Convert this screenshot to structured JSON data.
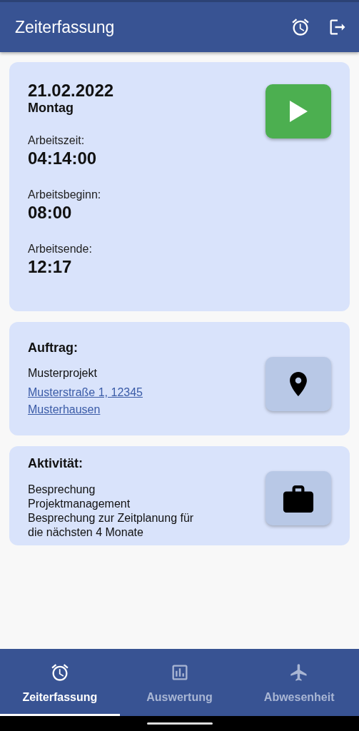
{
  "app_bar": {
    "title": "Zeiterfassung"
  },
  "time_card": {
    "date": "21.02.2022",
    "weekday": "Montag",
    "running": false,
    "fields": [
      {
        "label": "Arbeitszeit:",
        "value": "04:14:00"
      },
      {
        "label": "Arbeitsbeginn:",
        "value": "08:00"
      },
      {
        "label": "Arbeitsende:",
        "value": "12:17"
      }
    ]
  },
  "order_card": {
    "heading": "Auftrag:",
    "project": "Musterprojekt",
    "address": "Musterstraße 1, 12345 Musterhausen"
  },
  "activity_card": {
    "heading": "Aktivität:",
    "lines": [
      "Besprechung",
      "Projektmanagement",
      "Besprechung zur Zeitplanung für die nächsten 4 Monate"
    ]
  },
  "bottom_nav": [
    {
      "label": "Zeiterfassung",
      "selected": true
    },
    {
      "label": "Auswertung",
      "selected": false
    },
    {
      "label": "Abwesenheit",
      "selected": false
    }
  ]
}
